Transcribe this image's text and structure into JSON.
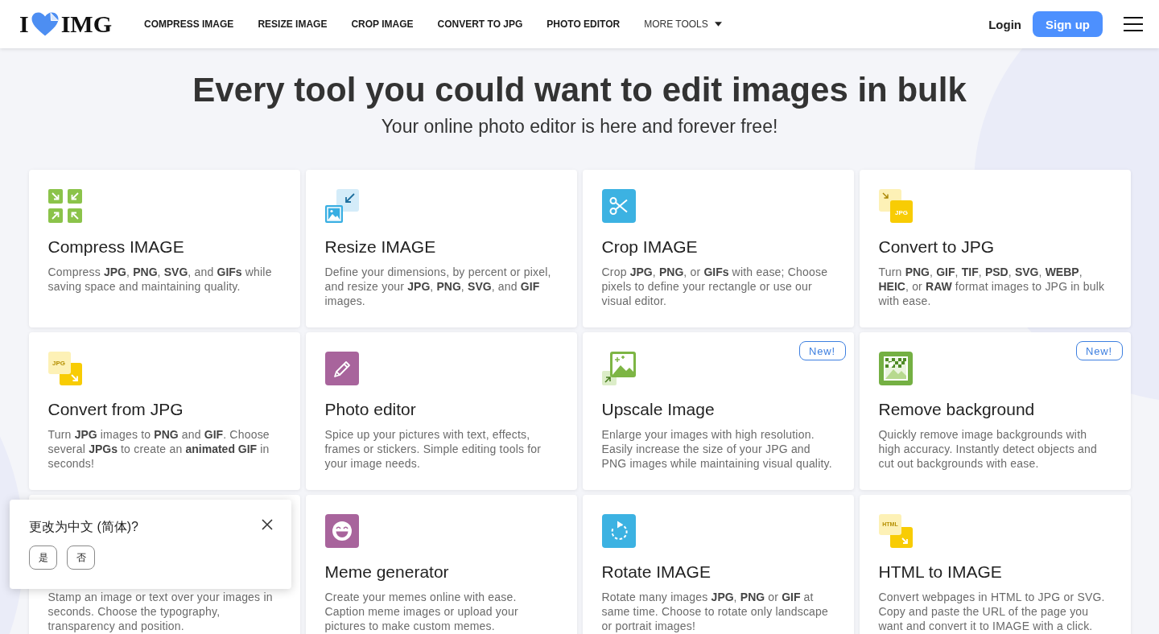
{
  "header": {
    "logo": {
      "left": "I",
      "right": "IMG"
    },
    "nav": [
      {
        "label": "COMPRESS IMAGE",
        "kind": "link"
      },
      {
        "label": "RESIZE IMAGE",
        "kind": "link"
      },
      {
        "label": "CROP IMAGE",
        "kind": "link"
      },
      {
        "label": "CONVERT TO JPG",
        "kind": "link"
      },
      {
        "label": "PHOTO EDITOR",
        "kind": "link"
      },
      {
        "label": "MORE TOOLS",
        "kind": "dropdown"
      }
    ],
    "login": "Login",
    "signup": "Sign up"
  },
  "hero": {
    "title": "Every tool you could want to edit images in bulk",
    "subtitle": "Your online photo editor is here and forever free!"
  },
  "tools": [
    {
      "kind": "compress",
      "title": "Compress IMAGE",
      "description": "Compress **JPG**, **PNG**, **SVG**, and **GIFs** while saving space and maintaining quality."
    },
    {
      "kind": "resize",
      "title": "Resize IMAGE",
      "description": "Define your dimensions, by percent or pixel, and resize your **JPG**, **PNG**, **SVG**, and **GIF** images."
    },
    {
      "kind": "crop",
      "title": "Crop IMAGE",
      "description": "Crop **JPG**, **PNG**, or **GIFs** with ease; Choose pixels to define your rectangle or use our visual editor."
    },
    {
      "kind": "convert-to",
      "icon_text": "JPG",
      "title": "Convert to JPG",
      "description": "Turn **PNG**, **GIF**, **TIF**, **PSD**, **SVG**, **WEBP**, **HEIC**, or **RAW** format images to JPG in bulk with ease."
    },
    {
      "kind": "convert-from",
      "icon_text": "JPG",
      "title": "Convert from JPG",
      "description": "Turn **JPG** images to **PNG** and **GIF**. Choose several **JPGs** to create an **animated GIF** in seconds!"
    },
    {
      "kind": "editor",
      "title": "Photo editor",
      "description": "Spice up your pictures with text, effects, frames or stickers. Simple editing tools for your image needs."
    },
    {
      "kind": "upscale",
      "badge": "New!",
      "title": "Upscale Image",
      "description": "Enlarge your images with high resolution. Easily increase the size of your JPG and PNG images while maintaining visual quality."
    },
    {
      "kind": "remove-bg",
      "badge": "New!",
      "title": "Remove background",
      "description": "Quickly remove image backgrounds with high accuracy. Instantly detect objects and cut out backgrounds with ease."
    },
    {
      "description": "Stamp an image or text over your images in seconds. Choose the typography, transparency and position."
    },
    {
      "kind": "meme",
      "title": "Meme generator",
      "description": "Create your memes online with ease. Caption meme images or upload your pictures to make custom memes."
    },
    {
      "kind": "rotate",
      "title": "Rotate IMAGE",
      "description": "Rotate many images **JPG**, **PNG** or **GIF** at same time. Choose to rotate only landscape or portrait images!"
    },
    {
      "kind": "html",
      "icon_text": "HTML",
      "title": "HTML to IMAGE",
      "description": "Convert webpages in HTML to JPG or SVG. Copy and paste the URL of the page you want and convert it to IMAGE with a click."
    }
  ],
  "language_prompt": {
    "message": "更改为中文 (简体)?",
    "buttons": [
      "是",
      "否"
    ]
  }
}
